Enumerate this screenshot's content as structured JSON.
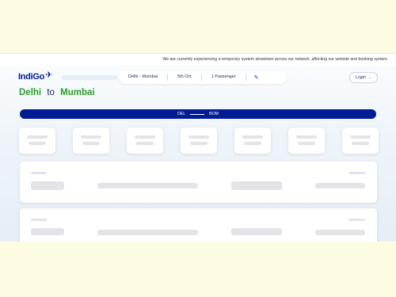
{
  "banner": {
    "text": "We are currently experiencing a temporary system slowdown across our network, affecting our website and booking system."
  },
  "header": {
    "logo_text": "IndiGo",
    "logo_icon": "plane-icon",
    "search": {
      "route": "Delhi - Mumbai",
      "date": "5th Oct",
      "passengers": "1 Passenger",
      "edit_icon": "pencil-icon"
    },
    "login_label": "Login",
    "login_icon": "chevron-down-icon"
  },
  "title": {
    "origin": "Delhi",
    "connector": "to",
    "destination": "Mumbai"
  },
  "route_bar": {
    "from_code": "DEL",
    "to_code": "BOM"
  },
  "colors": {
    "brand": "#001b94",
    "accent_green": "#2a9d28",
    "skeleton": "#e4e4e8"
  }
}
